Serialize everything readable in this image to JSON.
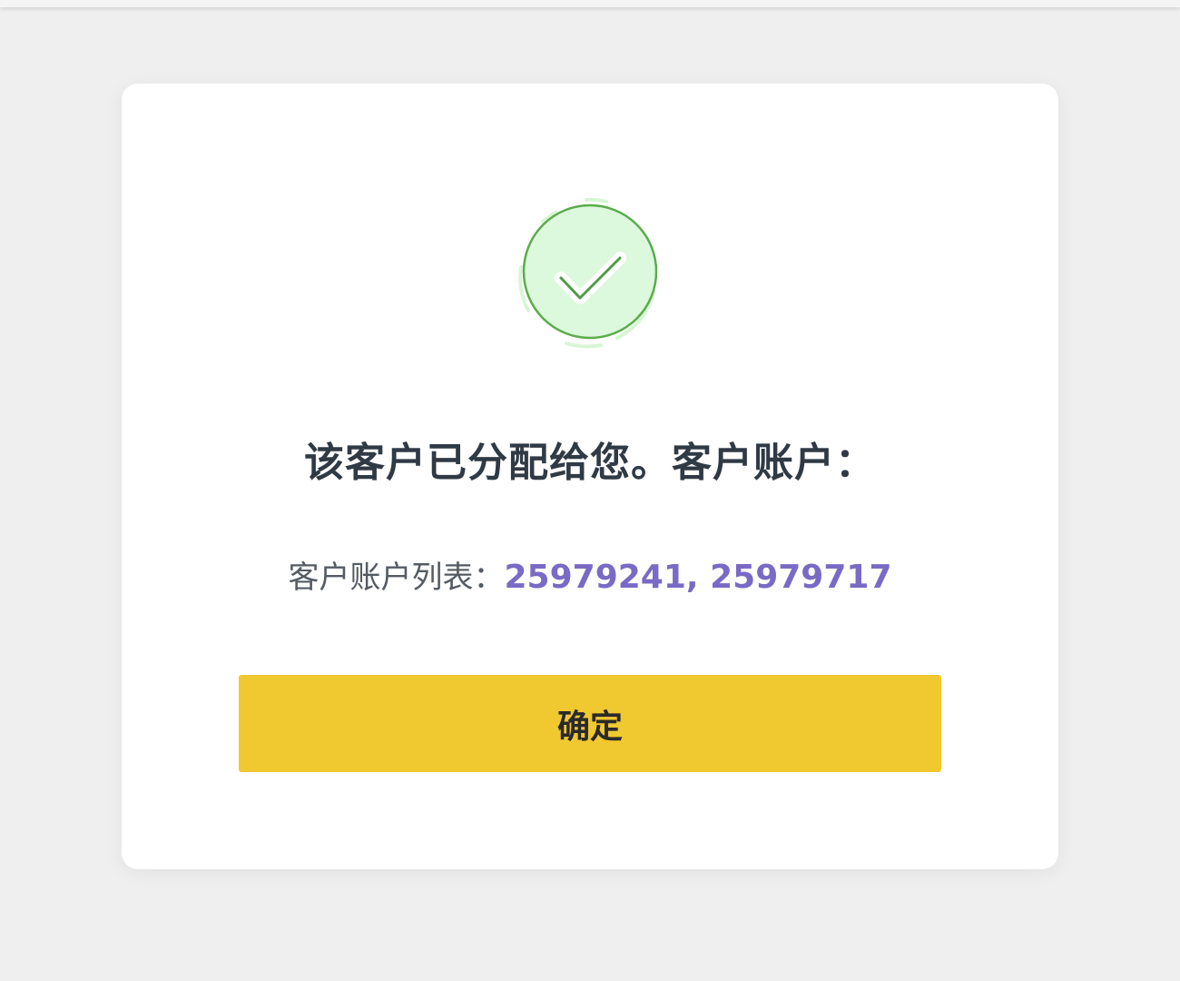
{
  "dialog": {
    "headline": "该客户已分配给您。客户账户：",
    "account_label": "客户账户列表：",
    "account_values": "25979241, 25979717",
    "confirm_label": "确定",
    "success_icon": "check-circle-icon"
  },
  "colors": {
    "page_background": "#efefef",
    "card_background": "#ffffff",
    "headline_text": "#303a45",
    "label_text": "#555b63",
    "account_values": "#7a6ac5",
    "button_background": "#f0c82f",
    "button_text": "#2a2a2a",
    "icon_fill": "#dcf8dd",
    "icon_stroke": "#5cac4c",
    "icon_halo": "#d8f6d6"
  }
}
